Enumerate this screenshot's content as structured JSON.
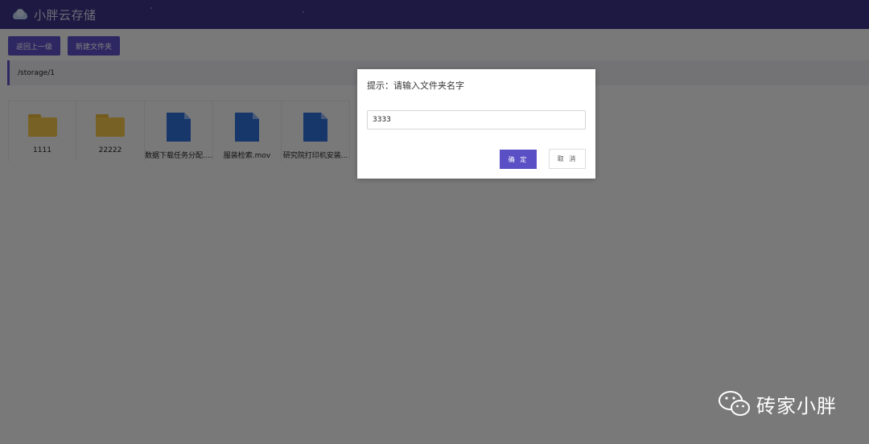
{
  "app": {
    "title": "小胖云存储"
  },
  "toolbar": {
    "back_label": "返回上一级",
    "new_folder_label": "新建文件夹"
  },
  "path": "/storage/1",
  "files": [
    {
      "name": "1111",
      "type": "folder"
    },
    {
      "name": "22222",
      "type": "folder"
    },
    {
      "name": "数据下载任务分配.zip",
      "type": "file"
    },
    {
      "name": "服装检索.mov",
      "type": "file"
    },
    {
      "name": "研究院打印机安装...",
      "type": "file"
    }
  ],
  "dialog": {
    "title": "提示：请输入文件夹名字",
    "input_value": "3333",
    "ok_label": "确 定",
    "cancel_label": "取 消"
  },
  "watermark": {
    "text": "砖家小胖",
    "icon": "wechat-icon"
  },
  "colors": {
    "topbar": "#3b3285",
    "accent": "#5a4fc4",
    "folder": "#f0c24a",
    "file": "#2f6fd6"
  }
}
